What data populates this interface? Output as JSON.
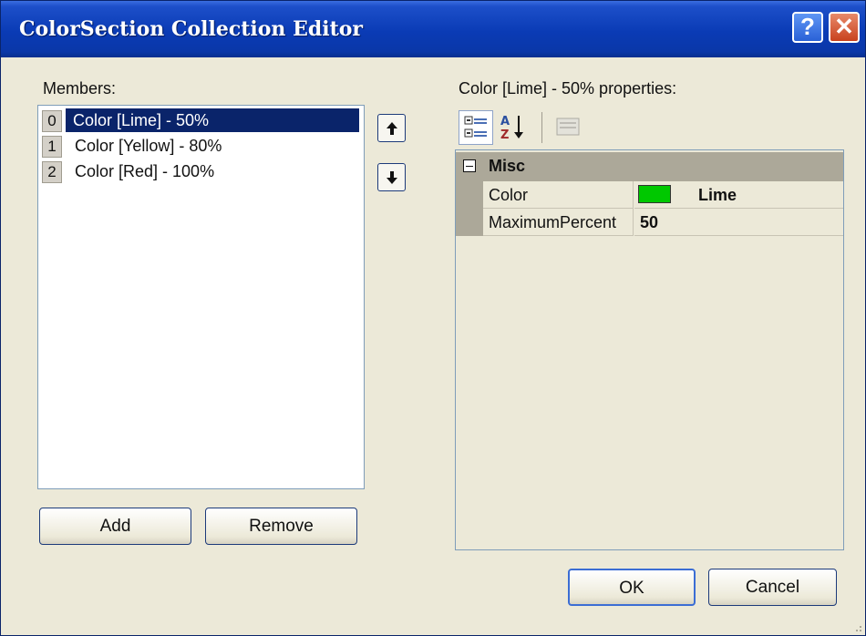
{
  "window": {
    "title": "ColorSection Collection Editor",
    "help_glyph": "?",
    "close_glyph": "✕"
  },
  "members": {
    "label": "Members:",
    "items": [
      {
        "index": "0",
        "text": "Color [Lime] - 50%",
        "selected": true
      },
      {
        "index": "1",
        "text": "Color [Yellow] - 80%",
        "selected": false
      },
      {
        "index": "2",
        "text": "Color [Red] - 100%",
        "selected": false
      }
    ]
  },
  "buttons": {
    "add": "Add",
    "remove": "Remove",
    "ok": "OK",
    "cancel": "Cancel"
  },
  "properties": {
    "label": "Color [Lime] - 50% properties:",
    "toolbar_icons": [
      "categorized-icon",
      "alphabetical-icon",
      "property-pages-icon"
    ],
    "category": "Misc",
    "rows": [
      {
        "name": "Color",
        "value": "Lime",
        "swatch": "#00c800"
      },
      {
        "name": "MaximumPercent",
        "value": "50"
      }
    ]
  },
  "colors": {
    "selection": "#0a246a",
    "titlebar": "#0a3bb5",
    "face": "#ece9d8"
  }
}
